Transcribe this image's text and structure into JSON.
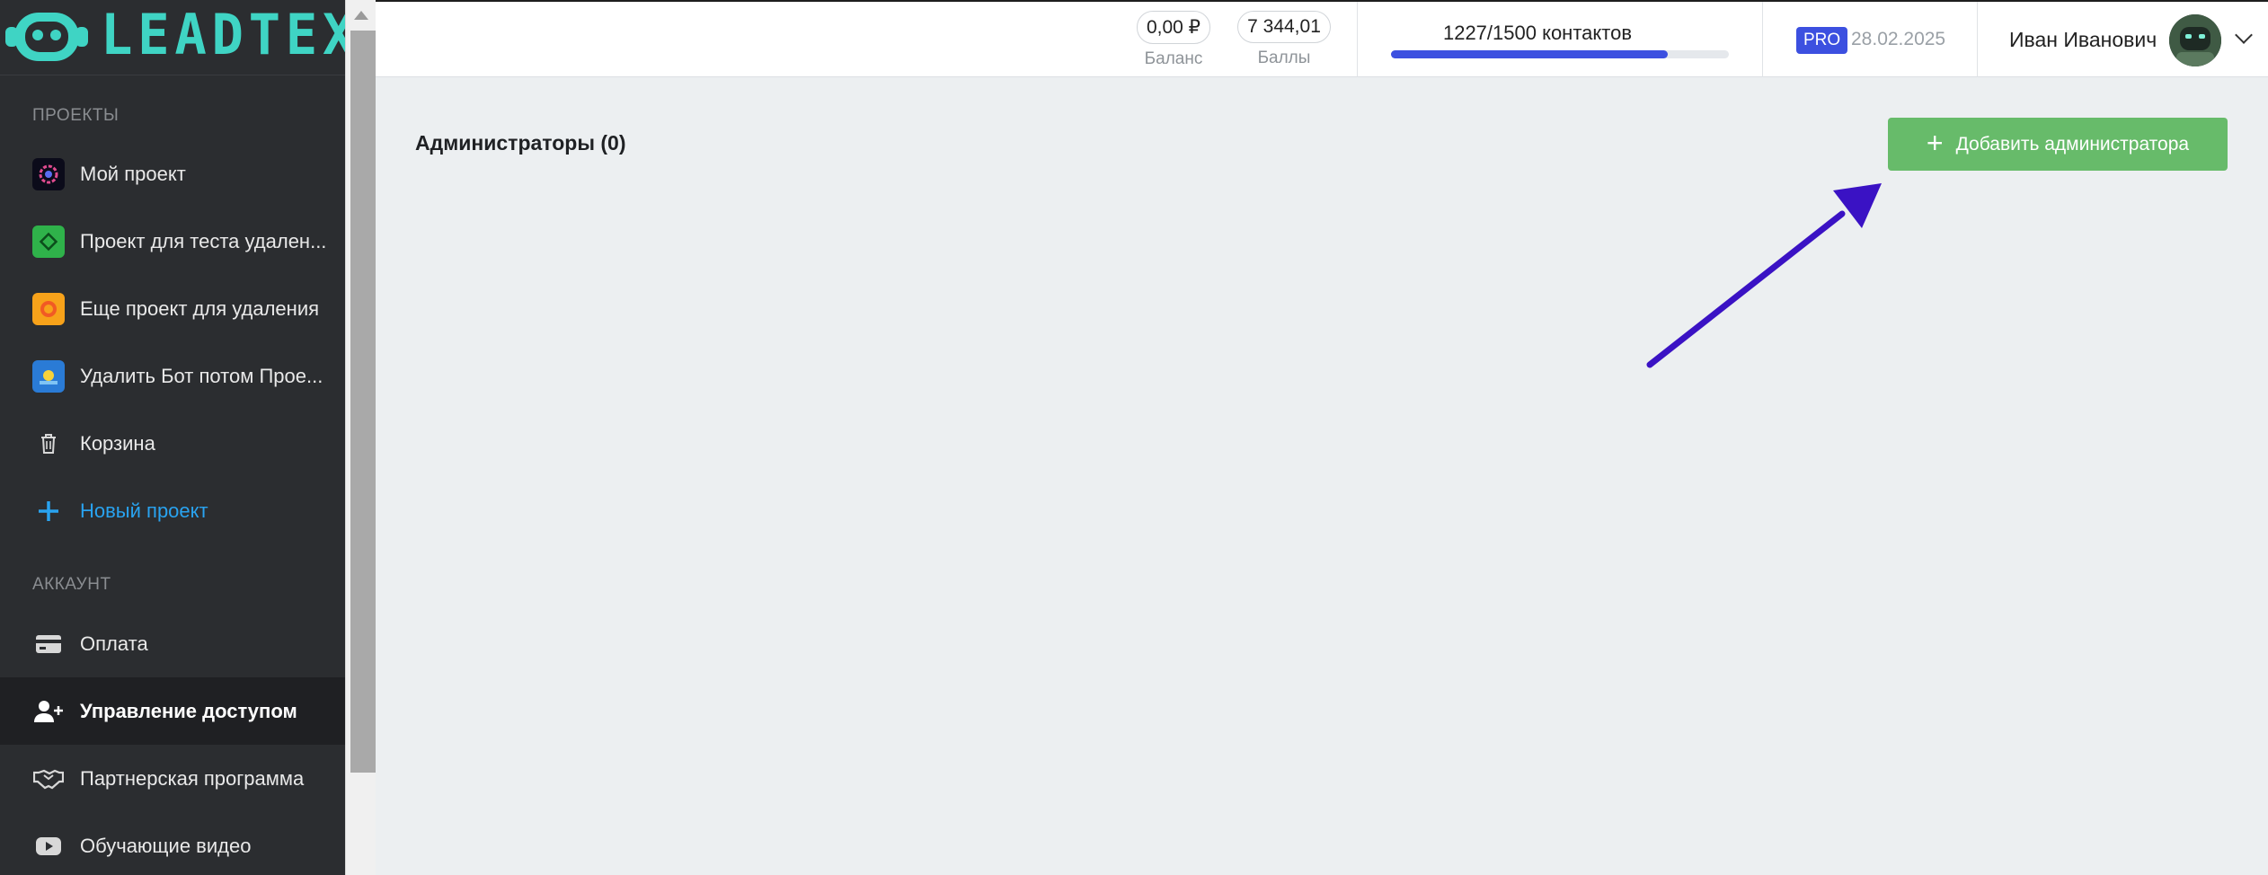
{
  "brand": {
    "logo_text": "LEADTEX"
  },
  "sidebar": {
    "projects_title": "ПРОЕКТЫ",
    "projects": [
      {
        "label": "Мой проект",
        "icon": "project-icon-1"
      },
      {
        "label": "Проект для теста удален...",
        "icon": "project-icon-2"
      },
      {
        "label": "Еще проект для удаления",
        "icon": "project-icon-3"
      },
      {
        "label": "Удалить Бот потом Прое...",
        "icon": "project-icon-4"
      },
      {
        "label": "Корзина",
        "icon": "trash-icon"
      },
      {
        "label": "Новый проект",
        "icon": "plus-icon"
      }
    ],
    "account_title": "АККАУНТ",
    "account": [
      {
        "label": "Оплата",
        "icon": "credit-card-icon"
      },
      {
        "label": "Управление доступом",
        "icon": "user-plus-icon",
        "active": true
      },
      {
        "label": "Партнерская программа",
        "icon": "handshake-icon"
      },
      {
        "label": "Обучающие видео",
        "icon": "youtube-icon"
      }
    ]
  },
  "topbar": {
    "balance_value": "0,00 ₽",
    "balance_label": "Баланс",
    "points_value": "7 344,01",
    "points_label": "Баллы",
    "contacts_text": "1227/1500 контактов",
    "contacts_used": 1227,
    "contacts_limit": 1500,
    "plan_badge": "PRO",
    "plan_date": "28.02.2025",
    "user_name": "Иван Иванович"
  },
  "main": {
    "title": "Администраторы (0)",
    "add_button_label": "Добавить администратора"
  },
  "colors": {
    "sidebar_bg": "#2b2d30",
    "accent_blue": "#3c50e0",
    "add_button": "#67bb6a",
    "new_project_link": "#29a3f0",
    "arrow": "#3a12c4"
  }
}
